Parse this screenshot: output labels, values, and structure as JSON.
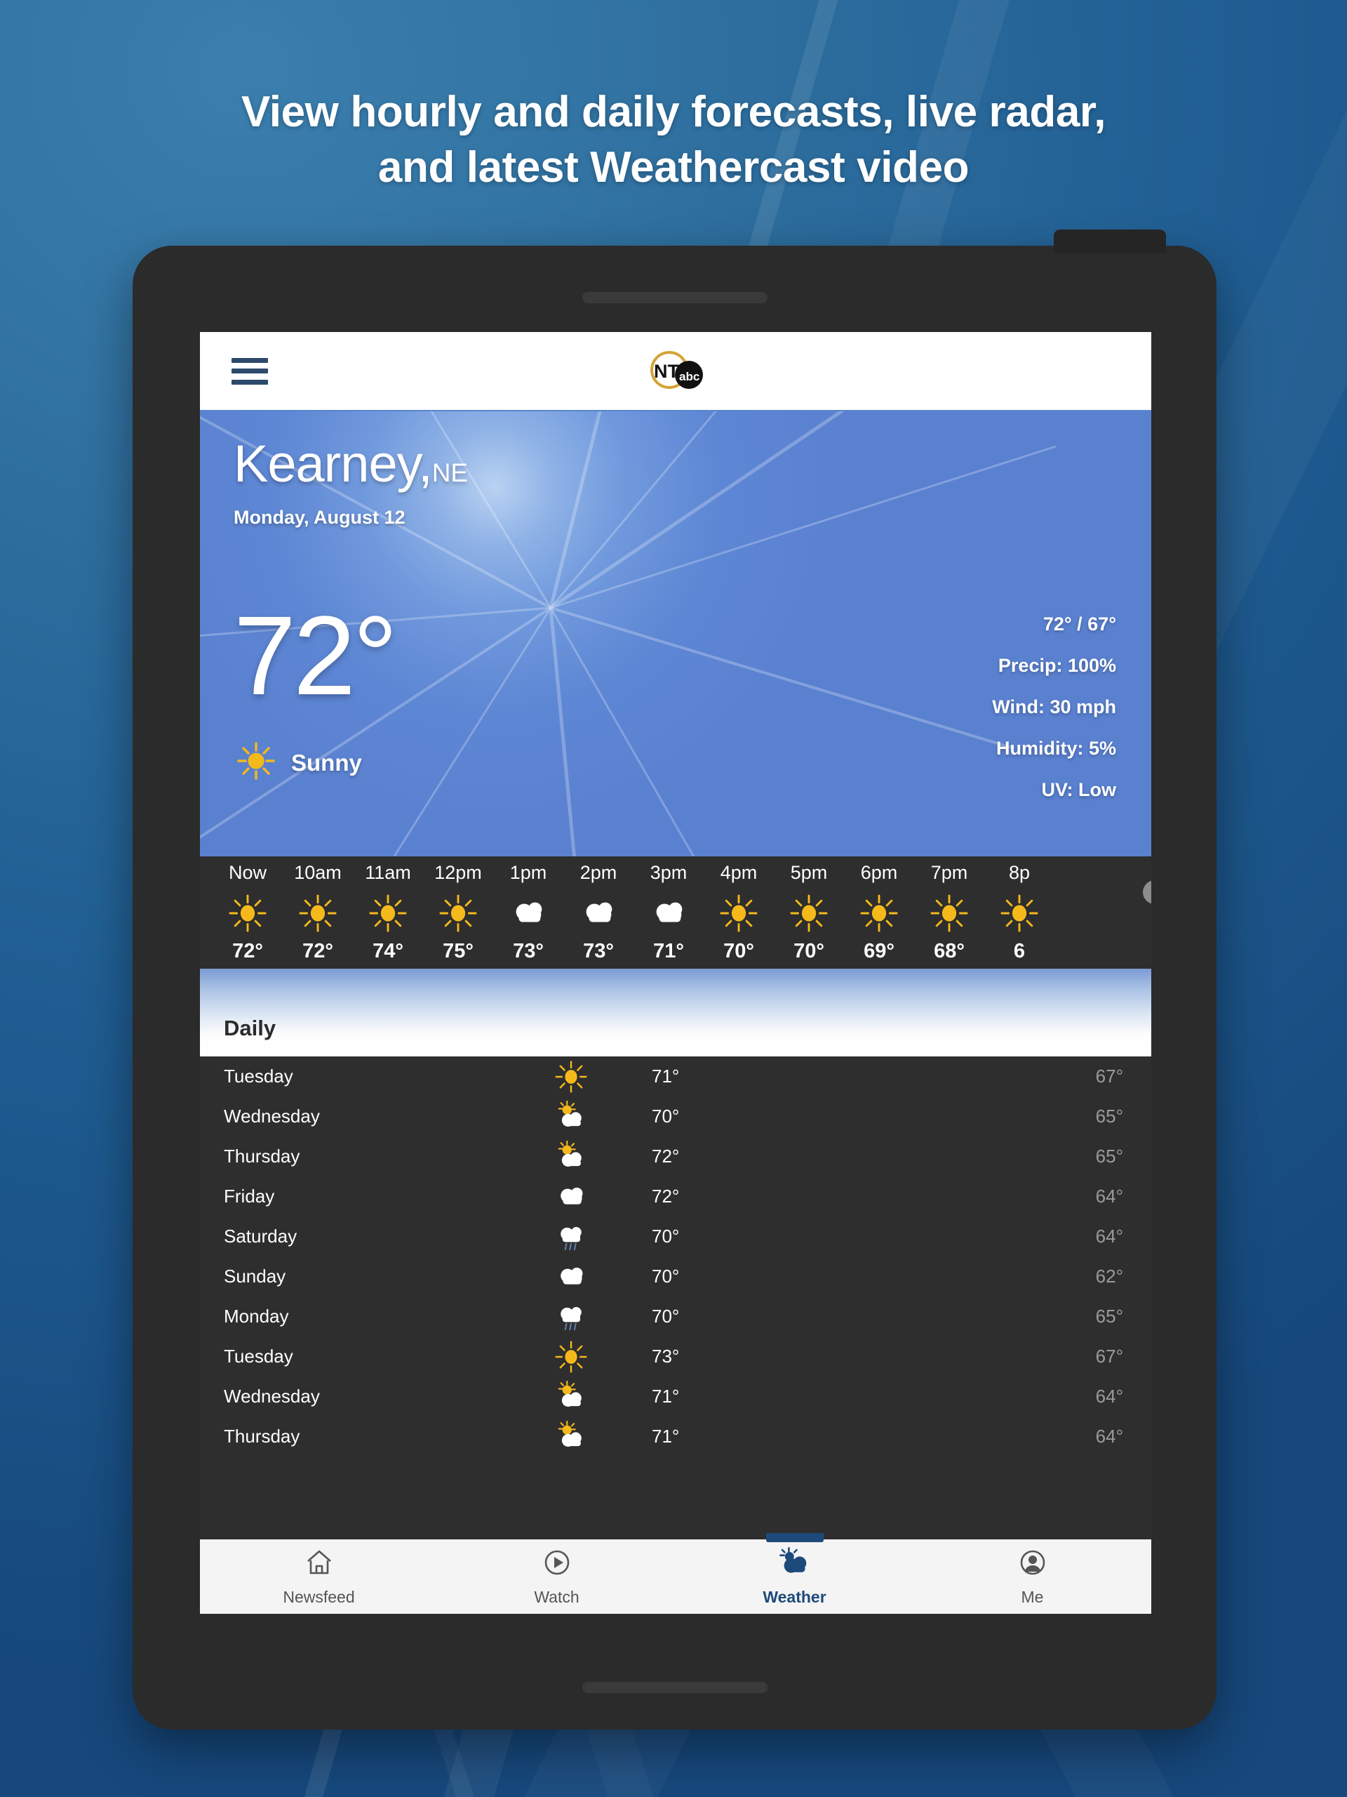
{
  "promo": {
    "headline_line1": "View hourly and daily forecasts, live radar,",
    "headline_line2": "and latest Weathercast video"
  },
  "colors": {
    "promo_background": "#1f5d92",
    "accent_blue": "#1d4a7a",
    "hero_blue": "#5a81d0",
    "sun_gold": "#f5b91b",
    "logo_gold": "#d4a437",
    "panel_dark": "#2e2e2e",
    "low_temp_gray": "#9b9b9b"
  },
  "appbar": {
    "menu_icon": "hamburger-menu-icon",
    "logo_primary": "NTV",
    "logo_secondary": "abc"
  },
  "hero": {
    "city": "Kearney,",
    "state": "NE",
    "date": "Monday, August 12",
    "temperature": "72°",
    "condition_icon": "sun-icon",
    "condition": "Sunny",
    "metrics": [
      "72° / 67°",
      "Precip: 100%",
      "Wind: 30 mph",
      "Humidity: 5%",
      "UV: Low"
    ]
  },
  "hourly": [
    {
      "label": "Now",
      "icon": "sun-icon",
      "temp": "72°"
    },
    {
      "label": "10am",
      "icon": "sun-icon",
      "temp": "72°"
    },
    {
      "label": "11am",
      "icon": "sun-icon",
      "temp": "74°"
    },
    {
      "label": "12pm",
      "icon": "sun-icon",
      "temp": "75°"
    },
    {
      "label": "1pm",
      "icon": "cloud-icon",
      "temp": "73°"
    },
    {
      "label": "2pm",
      "icon": "cloud-icon",
      "temp": "73°"
    },
    {
      "label": "3pm",
      "icon": "cloud-icon",
      "temp": "71°"
    },
    {
      "label": "4pm",
      "icon": "sun-icon",
      "temp": "70°"
    },
    {
      "label": "5pm",
      "icon": "sun-icon",
      "temp": "70°"
    },
    {
      "label": "6pm",
      "icon": "sun-icon",
      "temp": "69°"
    },
    {
      "label": "7pm",
      "icon": "sun-icon",
      "temp": "68°"
    },
    {
      "label": "8p",
      "icon": "sun-icon",
      "temp": "6"
    }
  ],
  "daily": {
    "title": "Daily",
    "rows": [
      {
        "day": "Tuesday",
        "icon": "sun-icon",
        "high": "71°",
        "low": "67°"
      },
      {
        "day": "Wednesday",
        "icon": "partly-sunny-icon",
        "high": "70°",
        "low": "65°"
      },
      {
        "day": "Thursday",
        "icon": "partly-sunny-icon",
        "high": "72°",
        "low": "65°"
      },
      {
        "day": "Friday",
        "icon": "cloud-icon",
        "high": "72°",
        "low": "64°"
      },
      {
        "day": "Saturday",
        "icon": "rain-icon",
        "high": "70°",
        "low": "64°"
      },
      {
        "day": "Sunday",
        "icon": "cloud-icon",
        "high": "70°",
        "low": "62°"
      },
      {
        "day": "Monday",
        "icon": "rain-icon",
        "high": "70°",
        "low": "65°"
      },
      {
        "day": "Tuesday",
        "icon": "sun-icon",
        "high": "73°",
        "low": "67°"
      },
      {
        "day": "Wednesday",
        "icon": "partly-sunny-icon",
        "high": "71°",
        "low": "64°"
      },
      {
        "day": "Thursday",
        "icon": "partly-sunny-icon",
        "high": "71°",
        "low": "64°"
      }
    ]
  },
  "bottomnav": {
    "items": [
      {
        "label": "Newsfeed",
        "icon": "home-icon",
        "active": false
      },
      {
        "label": "Watch",
        "icon": "play-circle-icon",
        "active": false
      },
      {
        "label": "Weather",
        "icon": "partly-cloudy-icon",
        "active": true
      },
      {
        "label": "Me",
        "icon": "account-icon",
        "active": false
      }
    ]
  }
}
